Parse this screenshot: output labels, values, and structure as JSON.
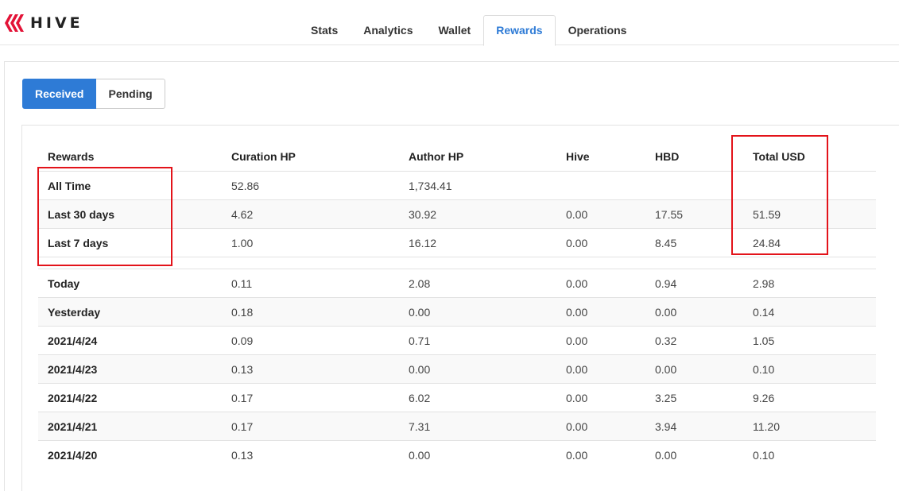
{
  "brand": {
    "name": "HIVE",
    "logo_color": "#e31337"
  },
  "nav": {
    "tabs": [
      {
        "label": "Stats"
      },
      {
        "label": "Analytics"
      },
      {
        "label": "Wallet"
      },
      {
        "label": "Rewards",
        "active": true
      },
      {
        "label": "Operations"
      }
    ]
  },
  "segment": {
    "received": "Received",
    "pending": "Pending",
    "active": "Received"
  },
  "colors": {
    "accent": "#2e7bd6",
    "highlight": "#e3131a"
  },
  "table": {
    "headers": [
      "Rewards",
      "Curation HP",
      "Author HP",
      "Hive",
      "HBD",
      "Total USD"
    ],
    "summary_rows": [
      [
        "All Time",
        "52.86",
        "1,734.41",
        "",
        "",
        ""
      ],
      [
        "Last 30 days",
        "4.62",
        "30.92",
        "0.00",
        "17.55",
        "51.59"
      ],
      [
        "Last 7 days",
        "1.00",
        "16.12",
        "0.00",
        "8.45",
        "24.84"
      ]
    ],
    "daily_rows": [
      [
        "Today",
        "0.11",
        "2.08",
        "0.00",
        "0.94",
        "2.98"
      ],
      [
        "Yesterday",
        "0.18",
        "0.00",
        "0.00",
        "0.00",
        "0.14"
      ],
      [
        "2021/4/24",
        "0.09",
        "0.71",
        "0.00",
        "0.32",
        "1.05"
      ],
      [
        "2021/4/23",
        "0.13",
        "0.00",
        "0.00",
        "0.00",
        "0.10"
      ],
      [
        "2021/4/22",
        "0.17",
        "6.02",
        "0.00",
        "3.25",
        "9.26"
      ],
      [
        "2021/4/21",
        "0.17",
        "7.31",
        "0.00",
        "3.94",
        "11.20"
      ],
      [
        "2021/4/20",
        "0.13",
        "0.00",
        "0.00",
        "0.00",
        "0.10"
      ]
    ]
  }
}
